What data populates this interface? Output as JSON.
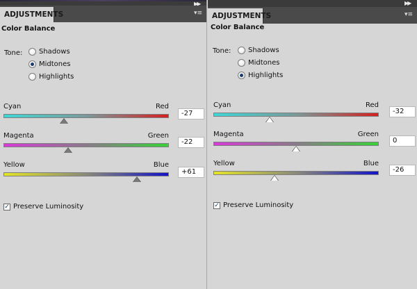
{
  "panels": [
    {
      "tab_label": "ADJUSTMENTS",
      "title": "Color Balance",
      "tone_label": "Tone:",
      "tone_options": [
        "Shadows",
        "Midtones",
        "Highlights"
      ],
      "tone_selected": "Midtones",
      "sliders": [
        {
          "left": "Cyan",
          "right": "Red",
          "value": "-27",
          "level": -27
        },
        {
          "left": "Magenta",
          "right": "Green",
          "value": "-22",
          "level": -22
        },
        {
          "left": "Yellow",
          "right": "Blue",
          "value": "+61",
          "level": 61
        }
      ],
      "preserve_luminosity_label": "Preserve Luminosity",
      "preserve_luminosity_checked": true
    },
    {
      "tab_label": "ADJUSTMENTS",
      "title": "Color Balance",
      "tone_label": "Tone:",
      "tone_options": [
        "Shadows",
        "Midtones",
        "Highlights"
      ],
      "tone_selected": "Highlights",
      "sliders": [
        {
          "left": "Cyan",
          "right": "Red",
          "value": "-32",
          "level": -32
        },
        {
          "left": "Magenta",
          "right": "Green",
          "value": "0",
          "level": 0
        },
        {
          "left": "Yellow",
          "right": "Blue",
          "value": "-26",
          "level": -26
        }
      ],
      "preserve_luminosity_label": "Preserve Luminosity",
      "preserve_luminosity_checked": true
    }
  ],
  "colors": {
    "panel_bg": "#d6d6d6",
    "cyan": "#3fd7d7",
    "red": "#d42020",
    "magenta": "#d83ad8",
    "green": "#36d336",
    "yellow": "#e4e427",
    "blue": "#1414c8"
  },
  "icons": {
    "collapse": "double-chevron-right-icon",
    "panel_menu": "panel-menu-icon"
  }
}
